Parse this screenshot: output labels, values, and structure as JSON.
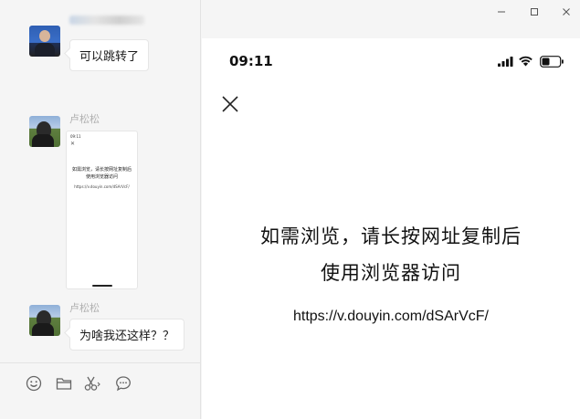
{
  "chat": {
    "messages": [
      {
        "sender": "",
        "text": "可以跳转了"
      },
      {
        "sender": "卢松松"
      },
      {
        "sender": "卢松松",
        "text": "为啥我还这样？？"
      }
    ],
    "thumbnail": {
      "time": "09:11",
      "line1": "如需浏览，请长按网址复制后",
      "line2": "使用浏览器访问",
      "url": "https://v.douyin.com/dSArVcF/"
    },
    "toolbar_icons": [
      "emoji-icon",
      "folder-icon",
      "scissors-icon",
      "chat-bubble-icon"
    ]
  },
  "window": {
    "controls": [
      "minimize-icon",
      "maximize-icon",
      "close-icon"
    ]
  },
  "preview": {
    "status_time": "09:11",
    "status_icons": [
      "signal-icon",
      "wifi-icon",
      "battery-icon"
    ],
    "line1": "如需浏览，请长按网址复制后",
    "line2": "使用浏览器访问",
    "url": "https://v.douyin.com/dSArVcF/"
  }
}
